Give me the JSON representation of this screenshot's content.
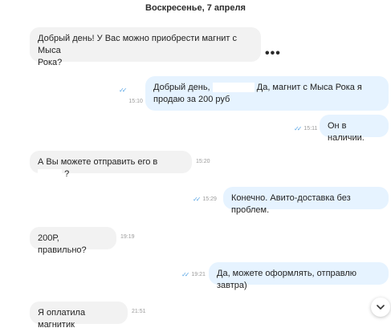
{
  "date_header": "Воскресенье, 7 апреля",
  "messages": [
    {
      "text_a": "Добрый день! У Вас можно приобрести магнит с Мыса",
      "text_b": "Рока?"
    },
    {
      "text_a": "Добрый день,",
      "text_b": "Да, магнит с Мыса Рока я",
      "text_c": "продаю за 200 руб",
      "time": "15:10"
    },
    {
      "text": "Он в наличии.",
      "time": "15:11"
    },
    {
      "text_a": "А Вы можете отправить его в",
      "text_b": "?",
      "time": "15:20"
    },
    {
      "text": "Конечно. Авито-доставка без проблем.",
      "time": "15:29"
    },
    {
      "text": "200Р, правильно?",
      "time": "19:19"
    },
    {
      "text": "Да, можете оформлять, отправлю завтра)",
      "time": "19:21"
    },
    {
      "text": "Я оплатила магнитик",
      "time": "21:51"
    }
  ],
  "more_icon": "•••",
  "scroll_down_icon": "chevron-down"
}
